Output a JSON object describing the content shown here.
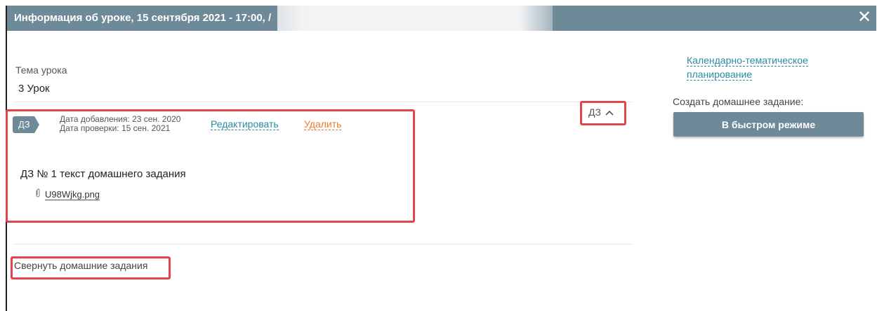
{
  "dialog": {
    "title": "Информация об уроке, 15 сентября 2021 - 17:00, /",
    "close_icon": "close-icon"
  },
  "lesson": {
    "topic_label": "Тема урока",
    "topic_value": "3 Урок"
  },
  "homework": {
    "tag": "ДЗ",
    "date_added": "Дата добавления: 23 сен. 2020",
    "date_checked": "Дата проверки: 15 сен. 2021",
    "edit_label": "Редактировать",
    "delete_label": "Удалить",
    "text": "ДЗ № 1 текст домашнего задания",
    "attachment": "U98Wjkg.png",
    "attachment_icon": "paperclip-icon"
  },
  "toggle": {
    "label": "ДЗ",
    "icon": "chevron-up-icon"
  },
  "collapse_label": "Свернуть домашние задания",
  "sidebar": {
    "ktp_link": "Календарно-тематическое планирование",
    "create_label": "Создать домашнее задание:",
    "quick_button": "В быстром режиме"
  },
  "colors": {
    "header": "#6e8a99",
    "link": "#2a8aa3",
    "delete": "#f07b2a",
    "highlight": "#e0454e"
  }
}
